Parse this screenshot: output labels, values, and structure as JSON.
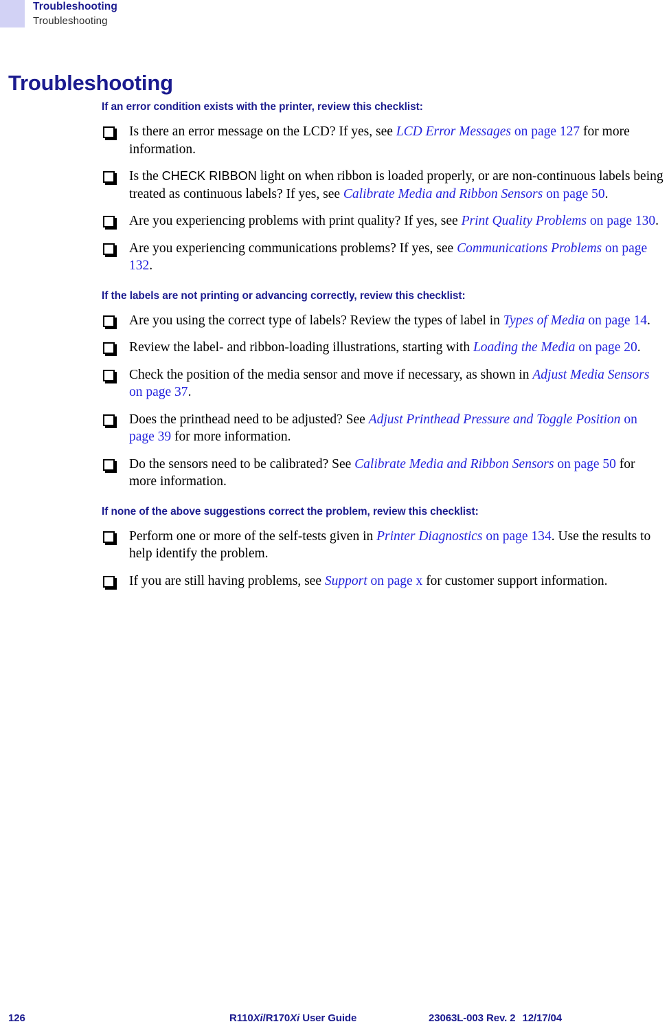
{
  "header": {
    "swatch_color": "#d2d2f5",
    "title": "Troubleshooting",
    "subtitle": "Troubleshooting"
  },
  "chapter": {
    "title": "Troubleshooting"
  },
  "colors": {
    "heading_blue": "#1b1b8f",
    "link_blue": "#2424dd",
    "body_black": "#000000",
    "header_swatch": "#d2d2f5"
  },
  "sections": [
    {
      "heading": "If an error condition exists with the printer, review this checklist:",
      "items": [
        {
          "parts": [
            {
              "type": "text",
              "value": "Is there an error message on the LCD? If yes, see "
            },
            {
              "type": "link-title",
              "value": "LCD Error Messages"
            },
            {
              "type": "text",
              "value": " "
            },
            {
              "type": "link-page",
              "value": "on page 127"
            },
            {
              "type": "text",
              "value": " for more information."
            }
          ]
        },
        {
          "parts": [
            {
              "type": "text",
              "value": "Is the "
            },
            {
              "type": "ui-label",
              "value": "CHECK RIBBON"
            },
            {
              "type": "text",
              "value": " light on when ribbon is loaded properly, or are non-continuous labels being treated as continuous labels? If yes, see "
            },
            {
              "type": "link-title",
              "value": "Calibrate Media and Ribbon Sensors"
            },
            {
              "type": "text",
              "value": " "
            },
            {
              "type": "link-page",
              "value": "on page 50"
            },
            {
              "type": "text",
              "value": "."
            }
          ]
        },
        {
          "parts": [
            {
              "type": "text",
              "value": "Are you experiencing problems with print quality? If yes, see "
            },
            {
              "type": "link-title",
              "value": "Print Quality Problems"
            },
            {
              "type": "text",
              "value": " "
            },
            {
              "type": "link-page",
              "value": "on page 130"
            },
            {
              "type": "text",
              "value": "."
            }
          ]
        },
        {
          "parts": [
            {
              "type": "text",
              "value": "Are you experiencing communications problems? If yes, see "
            },
            {
              "type": "link-title",
              "value": "Communications Problems"
            },
            {
              "type": "text",
              "value": " "
            },
            {
              "type": "link-page",
              "value": "on page 132"
            },
            {
              "type": "text",
              "value": "."
            }
          ]
        }
      ]
    },
    {
      "heading": "If the labels are not printing or advancing correctly, review this checklist:",
      "items": [
        {
          "parts": [
            {
              "type": "text",
              "value": "Are you using the correct type of labels? Review the types of label in "
            },
            {
              "type": "link-title",
              "value": "Types of Media"
            },
            {
              "type": "text",
              "value": " "
            },
            {
              "type": "link-page",
              "value": "on page 14"
            },
            {
              "type": "text",
              "value": "."
            }
          ]
        },
        {
          "parts": [
            {
              "type": "text",
              "value": "Review the label- and ribbon-loading illustrations, starting with "
            },
            {
              "type": "link-title",
              "value": "Loading the Media"
            },
            {
              "type": "text",
              "value": " "
            },
            {
              "type": "link-page",
              "value": "on page 20"
            },
            {
              "type": "text",
              "value": "."
            }
          ]
        },
        {
          "parts": [
            {
              "type": "text",
              "value": "Check the position of the media sensor and move if necessary, as shown in "
            },
            {
              "type": "link-title",
              "value": "Adjust Media Sensors"
            },
            {
              "type": "text",
              "value": " "
            },
            {
              "type": "link-page",
              "value": "on page 37"
            },
            {
              "type": "text",
              "value": "."
            }
          ]
        },
        {
          "parts": [
            {
              "type": "text",
              "value": "Does the printhead need to be adjusted? See "
            },
            {
              "type": "link-title",
              "value": "Adjust Printhead Pressure and Toggle Position"
            },
            {
              "type": "text",
              "value": " "
            },
            {
              "type": "link-page",
              "value": "on page 39"
            },
            {
              "type": "text",
              "value": " for more information."
            }
          ]
        },
        {
          "parts": [
            {
              "type": "text",
              "value": "Do the sensors need to be calibrated? See "
            },
            {
              "type": "link-title",
              "value": "Calibrate Media and Ribbon Sensors"
            },
            {
              "type": "text",
              "value": " "
            },
            {
              "type": "link-page",
              "value": "on page 50"
            },
            {
              "type": "text",
              "value": " for more information."
            }
          ]
        }
      ]
    },
    {
      "heading": "If none of the above suggestions correct the problem, review this checklist:",
      "items": [
        {
          "parts": [
            {
              "type": "text",
              "value": "Perform one or more of the self-tests given in "
            },
            {
              "type": "link-title",
              "value": "Printer Diagnostics"
            },
            {
              "type": "text",
              "value": " "
            },
            {
              "type": "link-page",
              "value": "on page 134"
            },
            {
              "type": "text",
              "value": ". Use the results to help identify the problem."
            }
          ]
        },
        {
          "parts": [
            {
              "type": "text",
              "value": "If you are still having problems, see "
            },
            {
              "type": "link-title",
              "value": "Support"
            },
            {
              "type": "text",
              "value": " "
            },
            {
              "type": "link-page",
              "value": "on page x"
            },
            {
              "type": "text",
              "value": " for customer support information."
            }
          ]
        }
      ]
    }
  ],
  "footer": {
    "page_number": "126",
    "guide_prefix": "R110",
    "guide_italic_1": "Xi",
    "guide_middle": "/R170",
    "guide_italic_2": "Xi",
    "guide_suffix": " User Guide",
    "doc_number": "23063L-003 Rev. 2",
    "doc_date": "12/17/04"
  }
}
